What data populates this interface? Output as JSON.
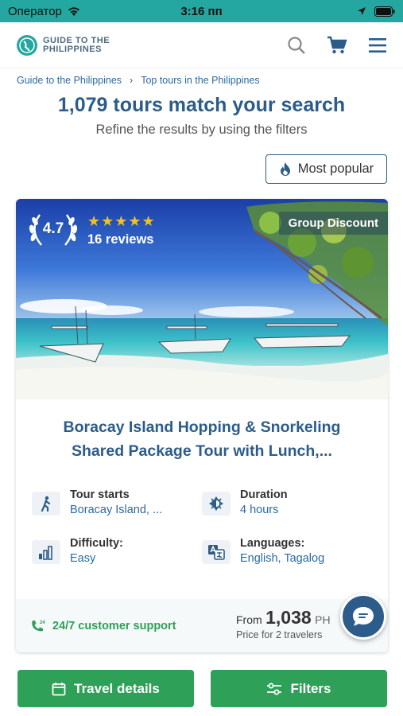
{
  "status_bar": {
    "carrier": "Оператор",
    "time": "3:16 пп"
  },
  "header": {
    "logo_line1": "GUIDE TO THE",
    "logo_line2": "PHILIPPINES",
    "icons": [
      "search-icon",
      "cart-icon",
      "menu-icon"
    ]
  },
  "breadcrumb": {
    "items": [
      {
        "label": "Guide to the Philippines"
      },
      {
        "label": "Top tours in the Philippines"
      }
    ],
    "separator": "›"
  },
  "results": {
    "title": "1,079 tours match your search",
    "subtitle": "Refine the results by using the filters",
    "sort_label": "Most popular"
  },
  "tour": {
    "rating": "4.7",
    "stars": "★★★★★",
    "reviews": "16 reviews",
    "badge": "Group Discount",
    "title_line1": "Boracay Island Hopping & Snorkeling",
    "title_line2": "Shared Package Tour with Lunch,...",
    "features": [
      {
        "label": "Tour starts",
        "value": "Boracay Island, ...",
        "icon": "hiker-icon"
      },
      {
        "label": "Duration",
        "value": "4 hours",
        "icon": "duration-icon"
      },
      {
        "label": "Difficulty:",
        "value": "Easy",
        "icon": "difficulty-bars-icon"
      },
      {
        "label": "Languages:",
        "value": "English, Tagalog",
        "icon": "language-icon"
      }
    ],
    "support": "24/7 customer support",
    "price_from": "From",
    "price_amount": "1,038",
    "price_currency": "PH",
    "price_note": "Price for 2 travelers"
  },
  "bottom": {
    "travel_details": "Travel details",
    "filters": "Filters"
  },
  "colors": {
    "status_bar": "#23a7a0",
    "brand_blue": "#2c5c8a",
    "link_blue": "#2b6aa0",
    "green": "#2ea057",
    "star": "#f4c020"
  }
}
